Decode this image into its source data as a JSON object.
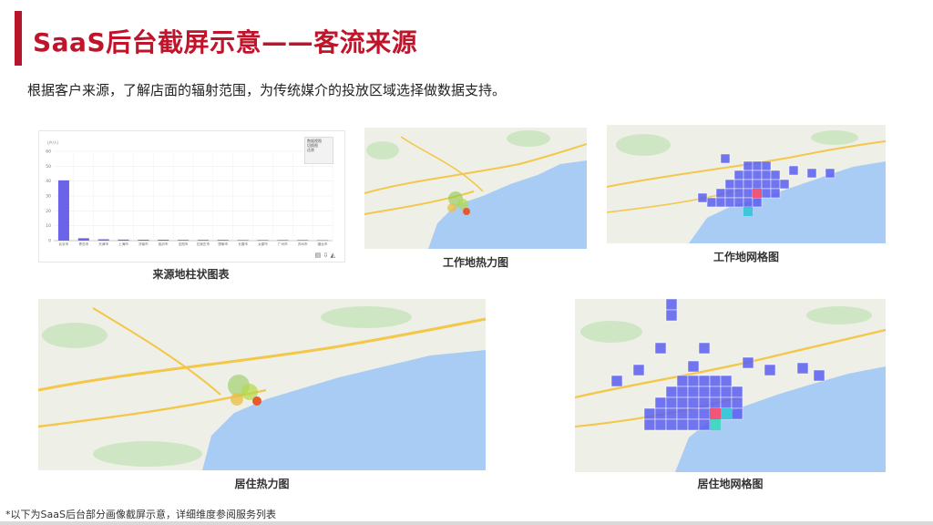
{
  "header": {
    "title": "SaaS后台截屏示意——客流来源",
    "subtitle": "根据客户来源，了解店面的辐射范围，为传统媒介的投放区域选择做数据支持。"
  },
  "panels": {
    "bar_chart_caption": "来源地柱状图表",
    "work_heat_caption": "工作地热力图",
    "work_grid_caption": "工作地网格图",
    "home_heat_caption": "居住热力图",
    "home_grid_caption": "居住地网格图"
  },
  "footnote": "*以下为SaaS后台部分画像截屏示意，详细维度参阅服务列表",
  "colors": {
    "accent": "#c0142b",
    "bar": "#6b63e8",
    "sea": "#a9ccf5",
    "land": "#eef0e8"
  },
  "chart_data": {
    "type": "bar",
    "ylabel": "(户/人)",
    "yticks": [
      0,
      10,
      20,
      30,
      40,
      50,
      60
    ],
    "ylim": [
      0,
      60
    ],
    "legend": [
      "数据视图",
      "切换图",
      "还原"
    ],
    "categories": [
      "北京市",
      "青岛市",
      "天津市",
      "上海市",
      "济南市",
      "临沂市",
      "沈阳市",
      "石家庄市",
      "邯郸市",
      "长春市",
      "太原市",
      "广州市",
      "苏州市",
      "烟台市"
    ],
    "values": [
      40.5,
      1.6,
      0.9,
      0.7,
      0.6,
      0.6,
      0.5,
      0.5,
      0.5,
      0.4,
      0.4,
      0.4,
      0.4,
      0.3
    ]
  }
}
